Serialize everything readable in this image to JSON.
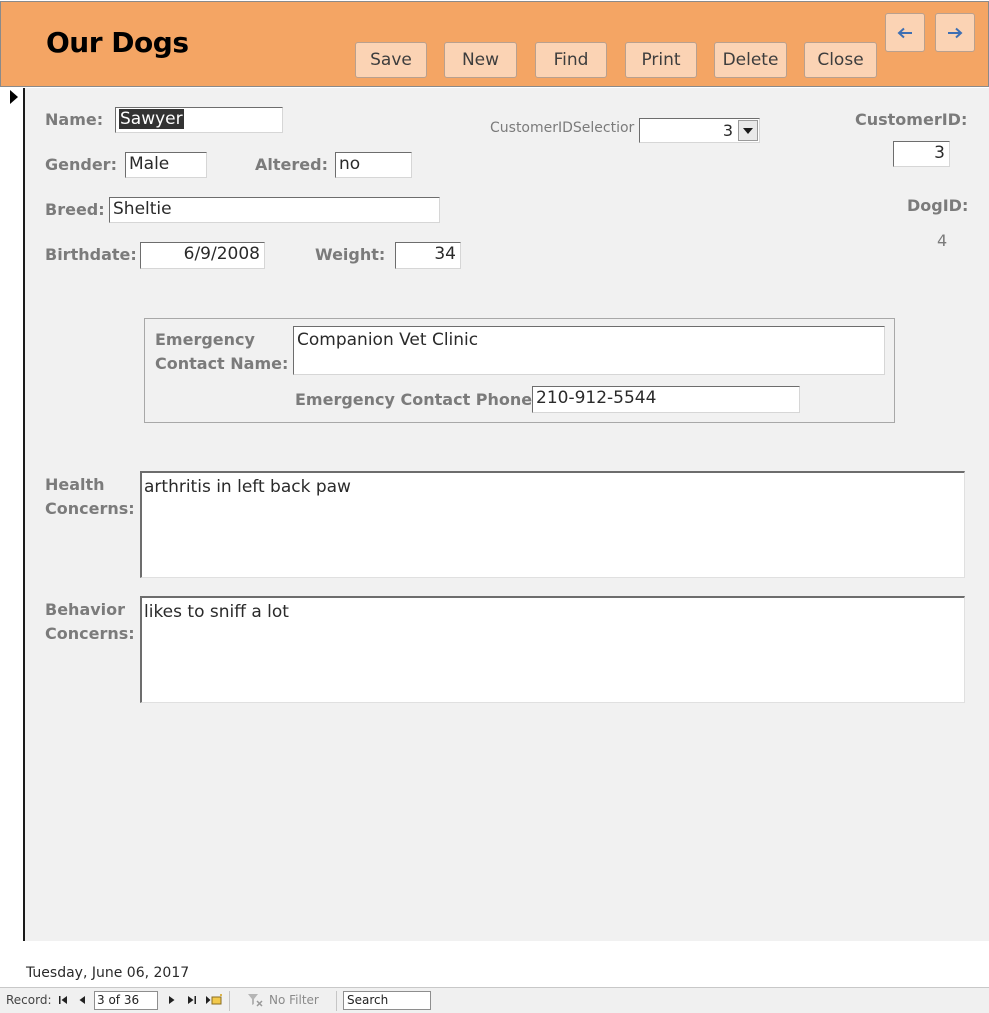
{
  "form": {
    "title": "Our Dogs"
  },
  "toolbar": {
    "save_label": "Save",
    "new_label": "New",
    "find_label": "Find",
    "print_label": "Print",
    "delete_label": "Delete",
    "close_label": "Close",
    "prev_icon": "arrow-left-icon",
    "next_icon": "arrow-right-icon"
  },
  "fields": {
    "name": {
      "label": "Name:",
      "value": "Sawyer"
    },
    "gender": {
      "label": "Gender:",
      "value": "Male"
    },
    "altered": {
      "label": "Altered:",
      "value": "no"
    },
    "breed": {
      "label": "Breed:",
      "value": "Sheltie"
    },
    "birthdate": {
      "label": "Birthdate:",
      "value": "6/9/2008"
    },
    "weight": {
      "label": "Weight:",
      "value": "34"
    },
    "customer_selection": {
      "label": "CustomerIDSelectior",
      "value": "3"
    },
    "customer_id": {
      "label": "CustomerID:",
      "value": "3"
    },
    "dog_id": {
      "label": "DogID:",
      "value": "4"
    },
    "emergency_name": {
      "label_line1": "Emergency",
      "label_line2": "Contact Name:",
      "value": "Companion Vet Clinic"
    },
    "emergency_phone": {
      "label": "Emergency Contact Phone:",
      "value": "210-912-5544"
    },
    "health": {
      "label_line1": "Health",
      "label_line2": "Concerns:",
      "value": "arthritis in left back paw"
    },
    "behavior": {
      "label_line1": "Behavior",
      "label_line2": "Concerns:",
      "value": "likes to sniff a lot"
    }
  },
  "footer": {
    "date": "Tuesday, June 06, 2017"
  },
  "navigation": {
    "record_label": "Record:",
    "record_position": "3 of 36",
    "filter_label": "No Filter",
    "search_placeholder": "Search"
  },
  "colors": {
    "header": "#f4a564",
    "button": "#fbd3b4",
    "label": "#7b7b7b",
    "detail_bg": "#f1f1f1"
  }
}
